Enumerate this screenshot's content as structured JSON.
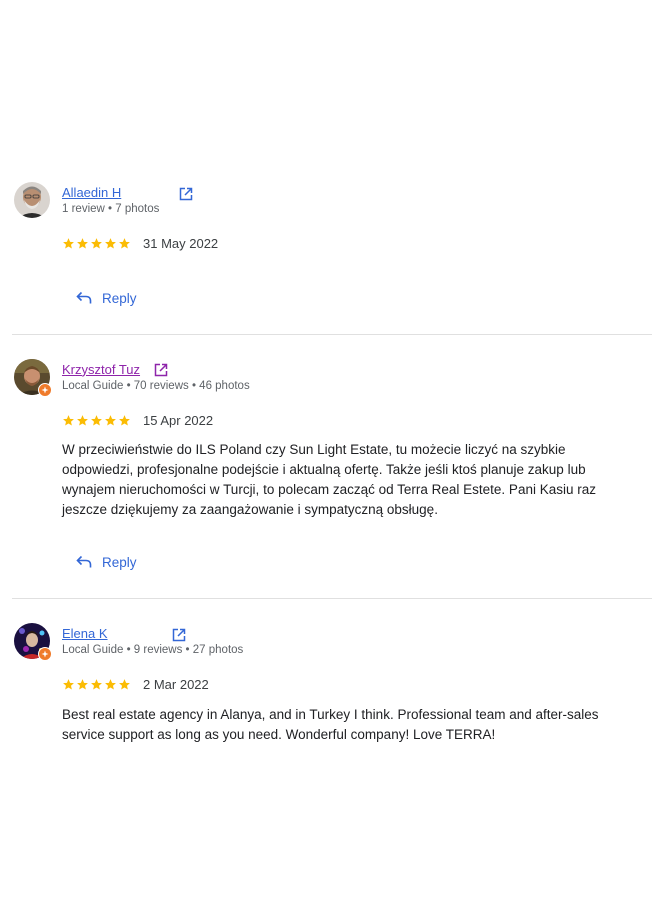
{
  "reviews": [
    {
      "author": "Allaedin H",
      "meta": "1 review • 7 photos",
      "rating": 5,
      "date": "31 May 2022",
      "text": "",
      "local_guide": false,
      "reply_label": "Reply"
    },
    {
      "author": "Krzysztof Tuz",
      "meta": "Local Guide • 70 reviews • 46 photos",
      "rating": 5,
      "date": "15 Apr 2022",
      "text": "W przeciwieństwie do ILS Poland czy Sun Light Estate, tu możecie liczyć na szybkie odpowiedzi, profesjonalne podejście i aktualną ofertę. Także jeśli ktoś planuje zakup lub wynajem nieruchomości w Turcji, to polecam zacząć od Terra Real Estete. Pani Kasiu raz jeszcze dziękujemy za zaangażowanie i sympatyczną obsługę.",
      "local_guide": true,
      "reply_label": "Reply"
    },
    {
      "author": "Elena K",
      "meta": "Local Guide • 9 reviews • 27 photos",
      "rating": 5,
      "date": "2 Mar 2022",
      "text": "Best real estate agency in Alanya, and in Turkey I think. Professional team and after-sales service support as long as you need. Wonderful company! Love TERRA!",
      "local_guide": true
    }
  ],
  "colors": {
    "link_blue": "#3367d6",
    "visited_purple": "#8e24aa",
    "star_gold": "#fbbc04",
    "guide_orange": "#ef7b2b",
    "divider": "#e0e0e0"
  },
  "icons": {
    "external_link": "open-in-new-icon",
    "reply": "reply-arrow-icon",
    "star": "star-icon",
    "local_guide_badge": "local-guide-badge-icon"
  }
}
